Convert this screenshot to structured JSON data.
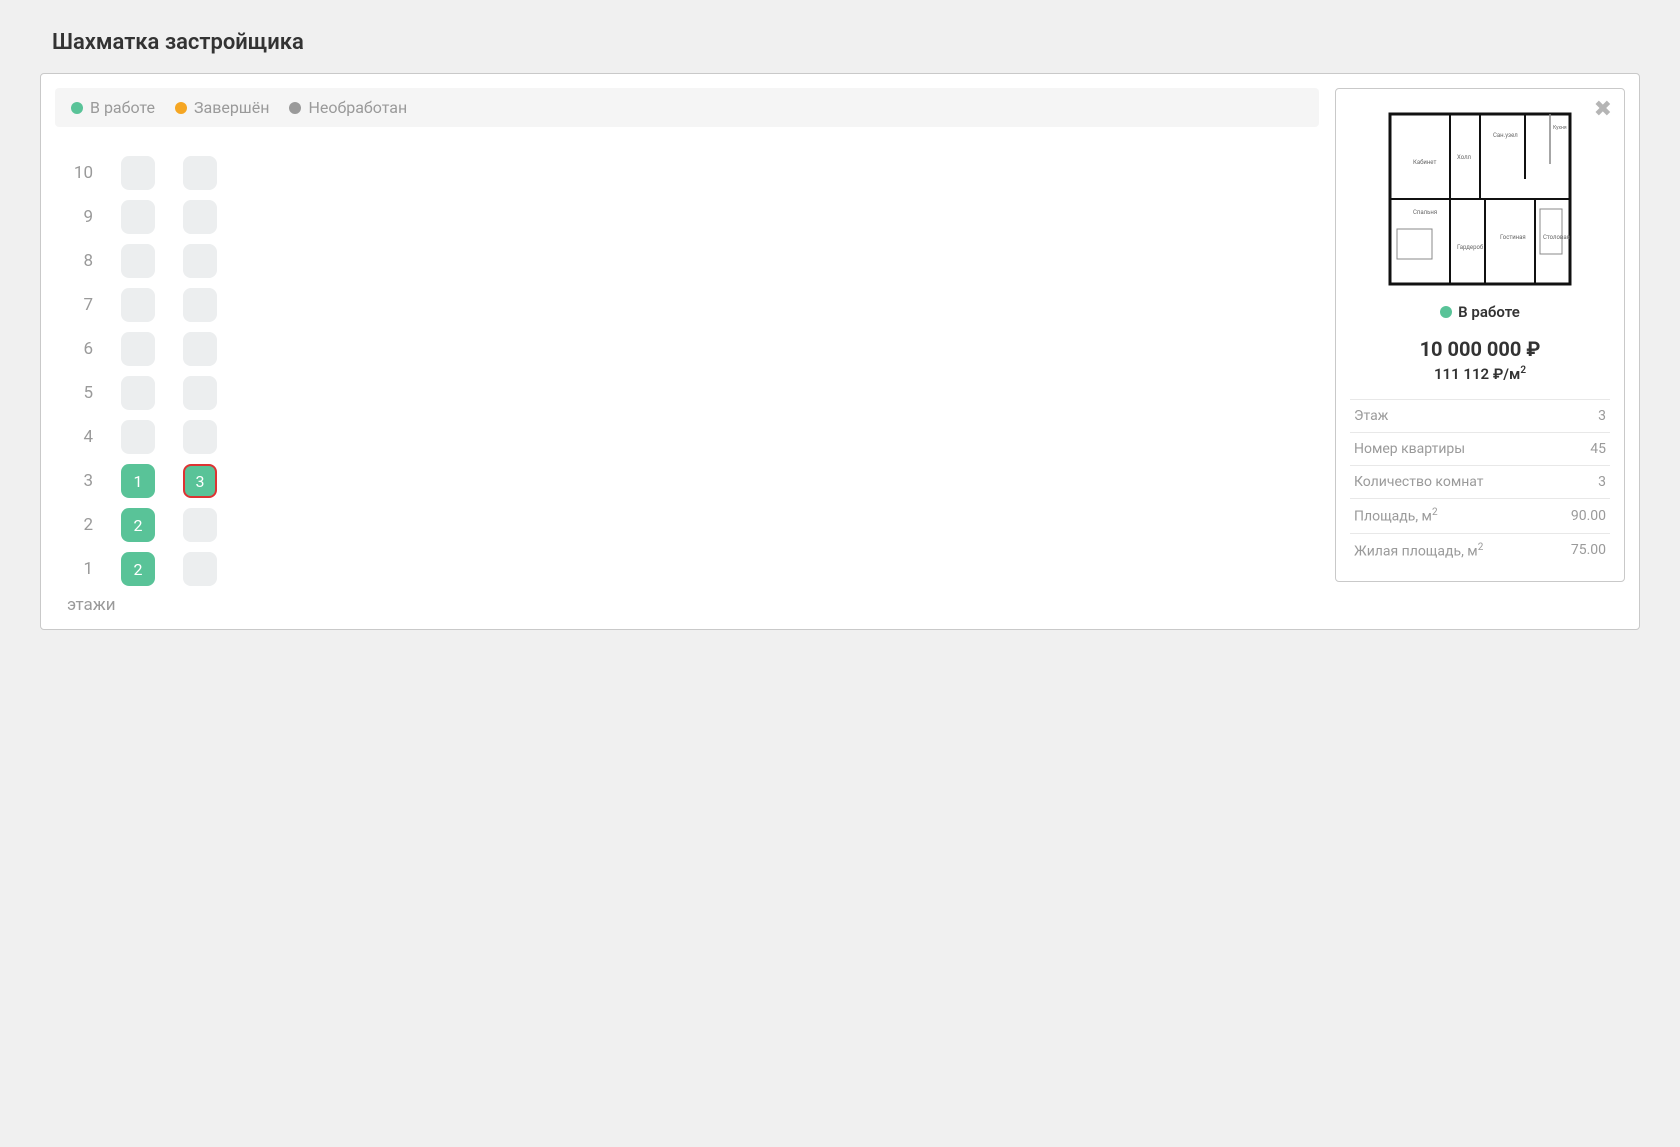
{
  "page": {
    "title": "Шахматка застройщика",
    "axis_label": "этажи"
  },
  "legend": [
    {
      "color": "green",
      "label": "В работе"
    },
    {
      "color": "orange",
      "label": "Завершён"
    },
    {
      "color": "gray",
      "label": "Необработан"
    }
  ],
  "floors": [
    {
      "num": "10",
      "cells": [
        {
          "status": "none"
        },
        {
          "status": "none"
        }
      ]
    },
    {
      "num": "9",
      "cells": [
        {
          "status": "none"
        },
        {
          "status": "none"
        }
      ]
    },
    {
      "num": "8",
      "cells": [
        {
          "status": "none"
        },
        {
          "status": "none"
        }
      ]
    },
    {
      "num": "7",
      "cells": [
        {
          "status": "none"
        },
        {
          "status": "none"
        }
      ]
    },
    {
      "num": "6",
      "cells": [
        {
          "status": "none"
        },
        {
          "status": "none"
        }
      ]
    },
    {
      "num": "5",
      "cells": [
        {
          "status": "none"
        },
        {
          "status": "none"
        }
      ]
    },
    {
      "num": "4",
      "cells": [
        {
          "status": "none"
        },
        {
          "status": "none"
        }
      ]
    },
    {
      "num": "3",
      "cells": [
        {
          "status": "green",
          "label": "1"
        },
        {
          "status": "green",
          "label": "3",
          "selected": true
        }
      ]
    },
    {
      "num": "2",
      "cells": [
        {
          "status": "green",
          "label": "2"
        },
        {
          "status": "none"
        }
      ]
    },
    {
      "num": "1",
      "cells": [
        {
          "status": "green",
          "label": "2"
        },
        {
          "status": "none"
        }
      ]
    }
  ],
  "detail": {
    "status_label": "В работе",
    "status_color": "green",
    "price": "10 000 000 ₽",
    "price_per_m2": "111 112 ₽/м",
    "rows": [
      {
        "label": "Этаж",
        "value": "3"
      },
      {
        "label": "Номер квартиры",
        "value": "45"
      },
      {
        "label": "Количество комнат",
        "value": "3"
      },
      {
        "label": "Площадь, м",
        "sup": "2",
        "value": "90.00"
      },
      {
        "label": "Жилая площадь, м",
        "sup": "2",
        "value": "75.00"
      }
    ]
  }
}
